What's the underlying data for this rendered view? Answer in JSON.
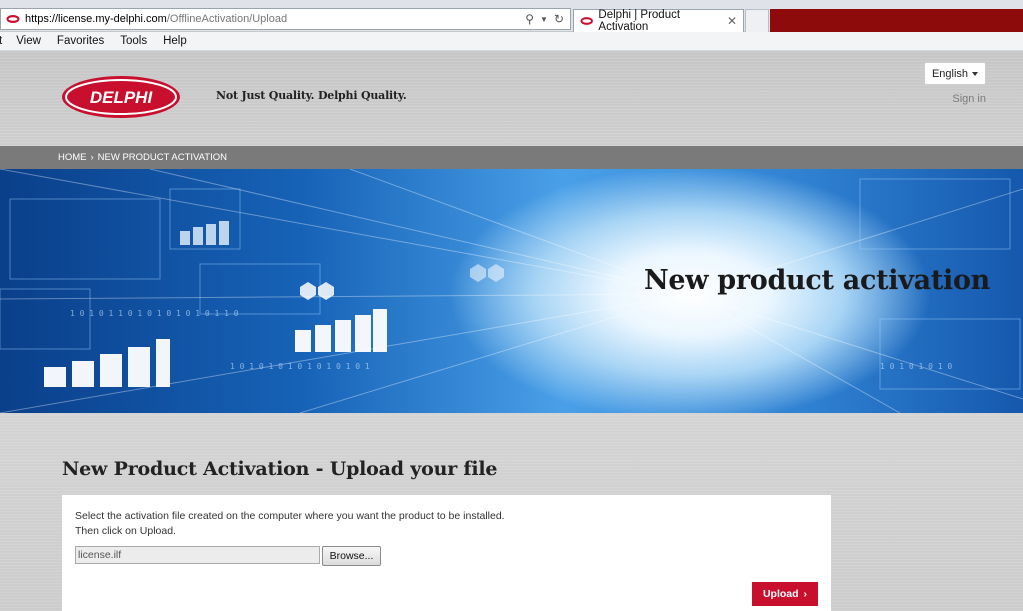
{
  "browser": {
    "url_host": "https://license.my-delphi.com",
    "url_path": "/OfflineActivation/Upload",
    "tab_title": "Delphi | Product Activation",
    "menu": [
      "t",
      "View",
      "Favorites",
      "Tools",
      "Help"
    ]
  },
  "header": {
    "logo_text": "DELPHI",
    "tagline": "Not Just Quality. Delphi Quality.",
    "language": "English",
    "signin": "Sign in"
  },
  "breadcrumb": {
    "home": "HOME",
    "separator": "›",
    "current": "NEW PRODUCT ACTIVATION"
  },
  "banner": {
    "title": "New product activation"
  },
  "section": {
    "title": "New Product Activation - Upload your file",
    "instruction_line1": "Select the activation file created on the computer where you want the product to be installed.",
    "instruction_line2": "Then click on Upload.",
    "file_value": "license.ilf",
    "browse_label": "Browse...",
    "upload_label": "Upload",
    "upload_arrow": "›"
  },
  "colors": {
    "brand_red": "#c8102e",
    "titlebar_red": "#8e0b0b",
    "breadcrumb_bg": "#7a7a7a"
  }
}
